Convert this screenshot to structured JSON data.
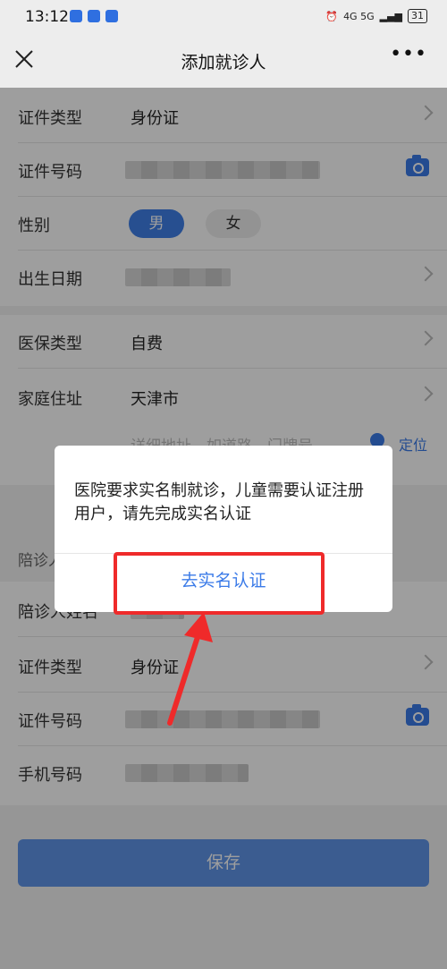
{
  "status_bar": {
    "time": "13:12",
    "battery": "31",
    "network": "4G 5G"
  },
  "nav": {
    "title": "添加就诊人",
    "more": "•••"
  },
  "patient": {
    "id_type": {
      "label": "证件类型",
      "value": "身份证"
    },
    "id_number": {
      "label": "证件号码"
    },
    "gender": {
      "label": "性别",
      "male": "男",
      "female": "女"
    },
    "birth_date": {
      "label": "出生日期"
    },
    "insurance": {
      "label": "医保类型",
      "value": "自费"
    },
    "address": {
      "label": "家庭住址",
      "value": "天津市",
      "placeholder": "详细地址，如道路、门牌号",
      "locate": "定位"
    }
  },
  "companion": {
    "header": "陪诊人信息",
    "name": {
      "label": "陪诊人姓名"
    },
    "id_type": {
      "label": "证件类型",
      "value": "身份证"
    },
    "id_number": {
      "label": "证件号码"
    },
    "phone": {
      "label": "手机号码"
    }
  },
  "save_button": "保存",
  "dialog": {
    "message": "医院要求实名制就诊，儿童需要认证注册用户，请先完成实名认证",
    "button": "去实名认证"
  },
  "colors": {
    "accent": "#3b7be8",
    "annotation": "#ef2a2a"
  }
}
